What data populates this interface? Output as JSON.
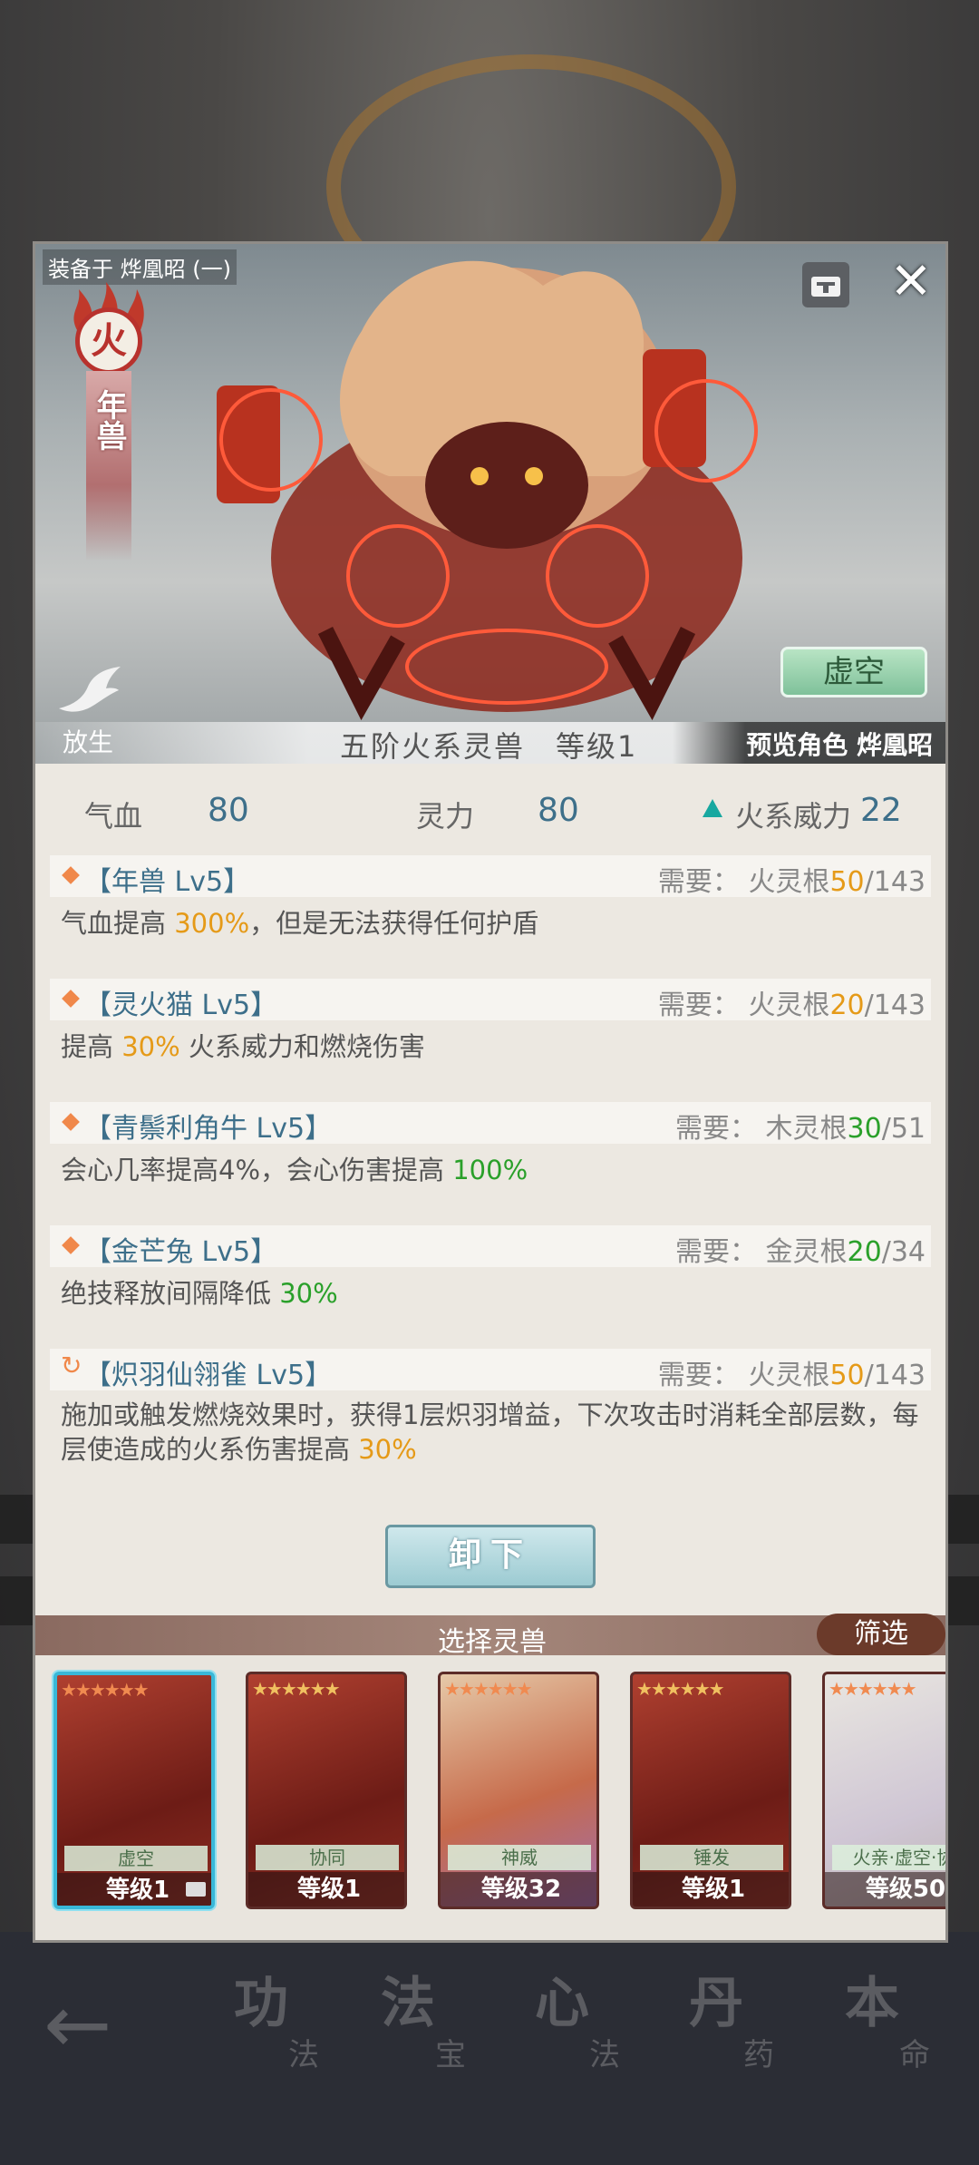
{
  "modal": {
    "equipped_to": "装备于 烨凰昭 (一)",
    "element": "火",
    "beast_name": "年兽",
    "release_label": "放生",
    "state_button": "虚空",
    "title": "五阶火系灵兽　等级1",
    "preview": "预览角色 烨凰昭"
  },
  "stats": {
    "hp_label": "气血",
    "hp": "80",
    "mp_label": "灵力",
    "mp": "80",
    "power_label": "火系威力",
    "power": "22"
  },
  "skills": [
    {
      "name": "【年兽 Lv5】",
      "req_label": "需要：",
      "req_root": "火灵根",
      "req_have": "50",
      "req_total": "/143",
      "desc_pre": "气血提高 ",
      "desc_hl": "300%",
      "desc_post": "，但是无法获得任何护盾"
    },
    {
      "name": "【灵火猫 Lv5】",
      "req_label": "需要：",
      "req_root": "火灵根",
      "req_have": "20",
      "req_total": "/143",
      "desc_pre": "提高 ",
      "desc_hl": "30%",
      "desc_post": " 火系威力和燃烧伤害"
    },
    {
      "name": "【青鬃利角牛 Lv5】",
      "req_label": "需要：",
      "req_root": "木灵根",
      "req_have": "30",
      "req_total": "/51",
      "desc_pre": "会心几率提高4%，会心伤害提高 ",
      "desc_hl": "100%",
      "desc_post": ""
    },
    {
      "name": "【金芒兔 Lv5】",
      "req_label": "需要：",
      "req_root": "金灵根",
      "req_have": "20",
      "req_total": "/34",
      "desc_pre": "绝技释放间隔降低 ",
      "desc_hl": "30%",
      "desc_post": ""
    },
    {
      "name": "【炽羽仙翎雀 Lv5】",
      "req_label": "需要：",
      "req_root": "火灵根",
      "req_have": "50",
      "req_total": "/143",
      "desc_pre": "施加或触发燃烧效果时，获得1层炽羽增益，下次攻击时消耗全部层数，每层使造成的火系伤害提高 ",
      "desc_hl": "30%",
      "desc_post": ""
    }
  ],
  "unequip_label": "卸下",
  "select_title": "选择灵兽",
  "filter_label": "筛选",
  "cards": [
    {
      "tag": "虚空",
      "level": "等级1"
    },
    {
      "tag": "协同",
      "level": "等级1"
    },
    {
      "tag": "神威",
      "level": "等级32"
    },
    {
      "tag": "锤发",
      "level": "等级1"
    },
    {
      "tag": "火亲·虚空·协",
      "level": "等级50"
    }
  ],
  "background_tabs": [
    {
      "big": "功",
      "small": "法"
    },
    {
      "big": "法",
      "small": "宝"
    },
    {
      "big": "心",
      "small": "法"
    },
    {
      "big": "丹",
      "small": "药"
    },
    {
      "big": "本",
      "small": "命"
    }
  ]
}
